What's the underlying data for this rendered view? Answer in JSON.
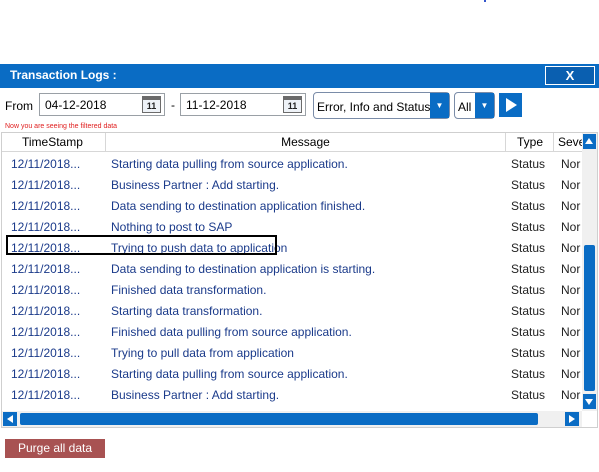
{
  "window": {
    "title": "Transaction Logs :",
    "close_label": "X"
  },
  "filters": {
    "from_label": "From",
    "from_date": "04-12-2018",
    "to_separator": "-",
    "to_date": "11-12-2018",
    "calendar_icon_text": "11",
    "log_type": "Error, Info and Status",
    "severity": "All",
    "note": "Now you are seeing the filtered data"
  },
  "grid": {
    "columns": [
      "TimeStamp",
      "Message",
      "Type",
      "Seve"
    ],
    "rows": [
      {
        "timestamp": "12/11/2018...",
        "message": "Starting data pulling from source application.",
        "type": "Status",
        "severity": "Nor"
      },
      {
        "timestamp": "12/11/2018...",
        "message": "Business Partner : Add starting.",
        "type": "Status",
        "severity": "Nor"
      },
      {
        "timestamp": "12/11/2018...",
        "message": "Data sending to destination application finished.",
        "type": "Status",
        "severity": "Nor"
      },
      {
        "timestamp": "12/11/2018...",
        "message": "Nothing to post to SAP",
        "type": "Status",
        "severity": "Nor"
      },
      {
        "timestamp": "12/11/2018...",
        "message": "Trying to push data to application",
        "type": "Status",
        "severity": "Nor"
      },
      {
        "timestamp": "12/11/2018...",
        "message": "Data sending to destination application is starting.",
        "type": "Status",
        "severity": "Nor"
      },
      {
        "timestamp": "12/11/2018...",
        "message": "Finished data transformation.",
        "type": "Status",
        "severity": "Nor"
      },
      {
        "timestamp": "12/11/2018...",
        "message": "Starting data transformation.",
        "type": "Status",
        "severity": "Nor"
      },
      {
        "timestamp": "12/11/2018...",
        "message": "Finished data pulling from source application.",
        "type": "Status",
        "severity": "Nor"
      },
      {
        "timestamp": "12/11/2018...",
        "message": "Trying to pull data from application",
        "type": "Status",
        "severity": "Nor"
      },
      {
        "timestamp": "12/11/2018...",
        "message": "Starting data pulling from source application.",
        "type": "Status",
        "severity": "Nor"
      },
      {
        "timestamp": "12/11/2018...",
        "message": "Business Partner : Add starting.",
        "type": "Status",
        "severity": "Nor"
      }
    ]
  },
  "actions": {
    "purge_label": "Purge all data"
  },
  "colors": {
    "accent": "#0a6cc4",
    "purge": "#a85252",
    "note": "#e02020",
    "text_link": "#1a3a8a"
  }
}
